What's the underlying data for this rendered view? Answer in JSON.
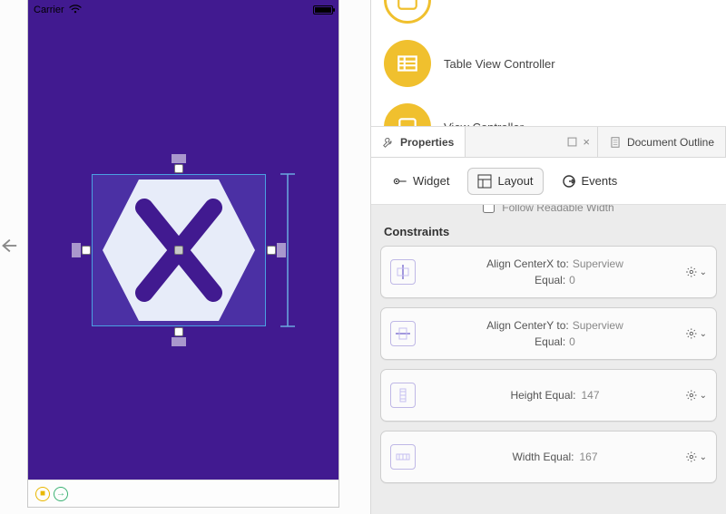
{
  "statusbar": {
    "carrier": "Carrier"
  },
  "library": {
    "item1": {
      "label": "Table View Controller"
    },
    "item2": {
      "label_partial": "View Controller"
    }
  },
  "tabs": {
    "properties": "Properties",
    "outline": "Document Outline"
  },
  "segments": {
    "widget": "Widget",
    "layout": "Layout",
    "events": "Events"
  },
  "panel": {
    "follow": "Follow Readable Width",
    "title": "Constraints"
  },
  "constraints": [
    {
      "line1_label": "Align CenterX to:",
      "line1_value": "Superview",
      "line2_label": "Equal:",
      "line2_value": "0"
    },
    {
      "line1_label": "Align CenterY to:",
      "line1_value": "Superview",
      "line2_label": "Equal:",
      "line2_value": "0"
    },
    {
      "label": "Height Equal:",
      "value": "147"
    },
    {
      "label": "Width Equal:",
      "value": "167"
    }
  ]
}
